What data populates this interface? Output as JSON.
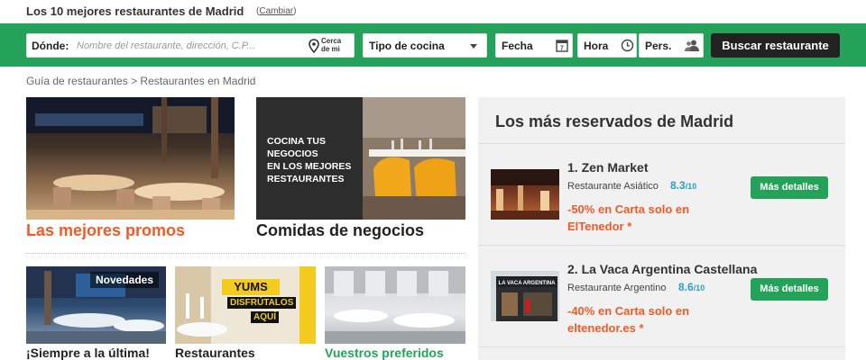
{
  "header": {
    "title": "Los 10 mejores restaurantes de Madrid",
    "change_link": "Cambiar"
  },
  "search": {
    "where_label": "Dónde:",
    "where_placeholder": "Nombre del restaurante, dirección, C.P...",
    "near_me_line1": "Cerca",
    "near_me_line2": "de mi",
    "cuisine_label": "Tipo de cocina",
    "date_label": "Fecha",
    "time_label": "Hora",
    "people_label": "Pers.",
    "submit_label": "Buscar restaurante"
  },
  "breadcrumb": "Guía de restaurantes > Restaurantes en Madrid",
  "features": [
    {
      "caption": "Las mejores promos",
      "caption_color": "#f05a28"
    },
    {
      "caption": "Comidas de negocios",
      "caption_color": "#222222",
      "overlay": [
        "COCINA TUS",
        "NEGOCIOS",
        "EN LOS MEJORES",
        "RESTAURANTES"
      ]
    }
  ],
  "small_features": [
    {
      "caption": "¡Siempre a la última!",
      "caption_color": "#222222",
      "badge": "Novedades"
    },
    {
      "caption": "Restaurantes",
      "caption_color": "#222222",
      "badge_line1": "YUMS",
      "badge_line2": "DISFRÚTALOS",
      "badge_line3": "AQUÍ"
    },
    {
      "caption": "Vuestros preferidos",
      "caption_color": "#25a25a"
    }
  ],
  "sidebar": {
    "title": "Los más reservados de Madrid",
    "items": [
      {
        "name": "1. Zen Market",
        "type": "Restaurante Asiático",
        "score": "8.3",
        "score_max": "/10",
        "promo": "-50% en Carta solo en ElTenedor *",
        "details_label": "Más detalles"
      },
      {
        "name": "2. La Vaca Argentina Castellana",
        "type": "Restaurante Argentino",
        "score": "8.6",
        "score_max": "/10",
        "promo": "-40% en Carta solo en eltenedor.es *",
        "details_label": "Más detalles",
        "thumb_sign": "LA VACA ARGENTINA"
      }
    ]
  },
  "colors": {
    "brand_green": "#25a25a",
    "promo_orange": "#f05a28",
    "score_blue": "#2a9fc4"
  }
}
